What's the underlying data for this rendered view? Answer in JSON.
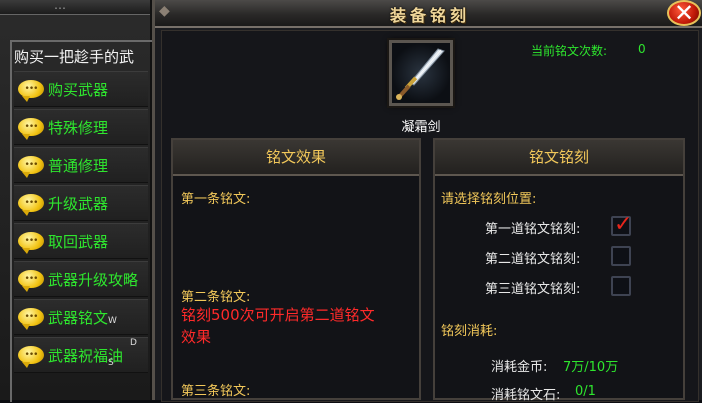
{
  "left_panel": {
    "top_strip_text": "…",
    "npc_greeting": "购买一把趁手的武",
    "menu": [
      {
        "label": "购买武器",
        "icon": "chat-bubble-icon"
      },
      {
        "label": "特殊修理",
        "icon": "chat-bubble-icon"
      },
      {
        "label": "普通修理",
        "icon": "chat-bubble-icon"
      },
      {
        "label": "升级武器",
        "icon": "chat-bubble-icon"
      },
      {
        "label": "取回武器",
        "icon": "chat-bubble-icon"
      },
      {
        "label": "武器升级攻略",
        "icon": "chat-bubble-icon"
      },
      {
        "label": "武器铭文",
        "icon": "chat-bubble-icon"
      },
      {
        "label": "武器祝福油",
        "icon": "chat-bubble-icon"
      }
    ],
    "joystick_letters": {
      "w": "W",
      "s": "S",
      "d": "D"
    }
  },
  "window": {
    "title": "装备铭刻",
    "close_icon": "close-icon",
    "engrave_count_label": "当前铭文次数:",
    "engrave_count_value": "0"
  },
  "weapon": {
    "name": "凝霜剑",
    "icon": "sword-icon"
  },
  "effect_panel": {
    "header": "铭文效果",
    "slot1_label": "第一条铭文:",
    "slot2_label": "第二条铭文:",
    "slot2_hint_line1": "铭刻500次可开启第二道铭文",
    "slot2_hint_line2": "效果",
    "slot3_label": "第三条铭文:"
  },
  "engrave_panel": {
    "header": "文铭刻",
    "choose_label": "请选择铭刻位置:",
    "slots": [
      {
        "label": "第一道铭文铭刻:",
        "checked": true
      },
      {
        "label": "第二道铭文铭刻:",
        "checked": false
      },
      {
        "label": "第三道铭文铭刻:",
        "checked": false
      }
    ],
    "cost_label": "铭刻消耗:",
    "gold_label": "消耗金币:",
    "gold_value": "7万/10万",
    "stone_label": "消耗铭文石:",
    "stone_value": "0/1"
  },
  "colors": {
    "menu_green": "#2ee62e",
    "header_gold": "#f2c85a",
    "warning_red": "#ff2a2a",
    "title_gold": "#f0d79a"
  }
}
